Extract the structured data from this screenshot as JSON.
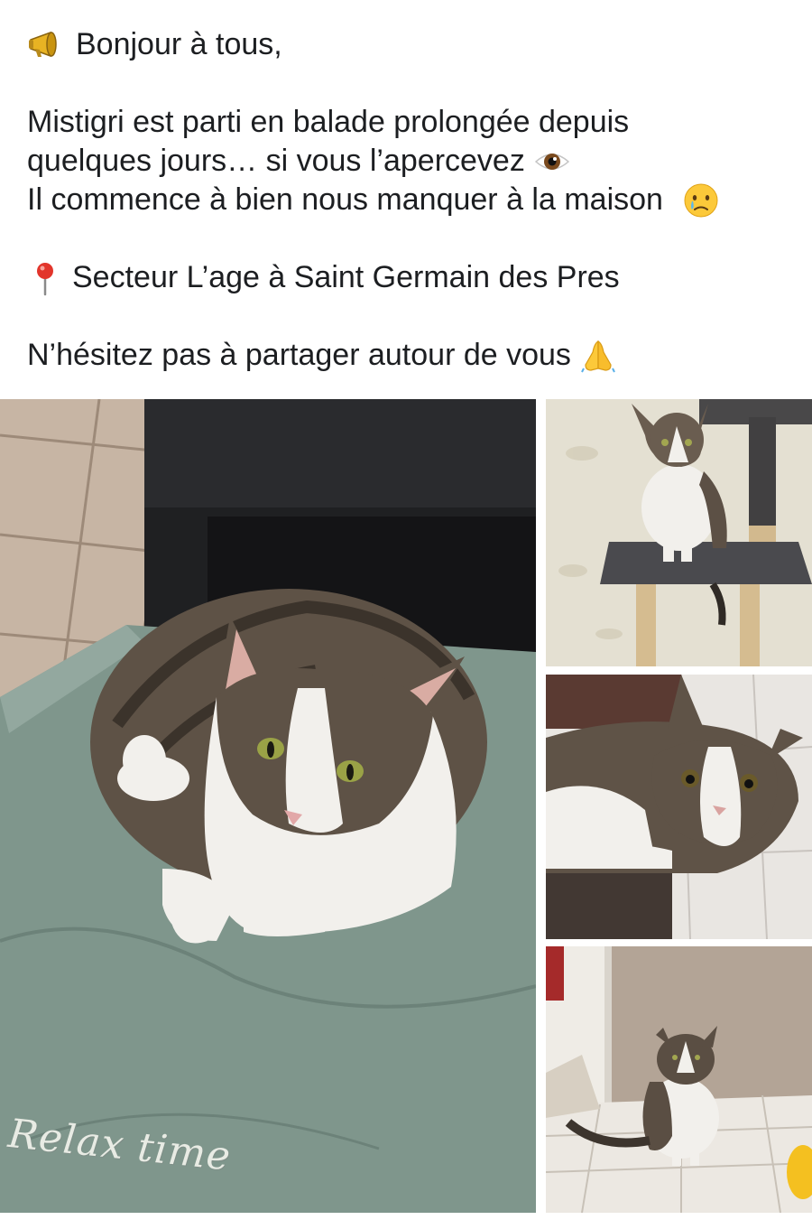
{
  "post": {
    "greeting_icon": "megaphone-icon",
    "greeting": "Bonjour à tous,",
    "line1": "Mistigri est parti en balade prolongée depuis",
    "line2": "quelques jours… si vous l’apercevez",
    "line2_icon": "eye-icon",
    "line3": "Il commence à bien nous manquer à la maison",
    "line3_icon": "sad-tear-face-icon",
    "location_icon": "pin-icon",
    "location": "Secteur L’age à Saint Germain des Pres",
    "line5": "N’hésitez pas à partager autour de vous",
    "line5_icon": "praying-hands-icon"
  },
  "gallery": {
    "main_photo_caption": "Relax time",
    "photos": [
      {
        "subject": "cat lying on green cushion"
      },
      {
        "subject": "cat sitting on cat tree"
      },
      {
        "subject": "cat close-up lying down"
      },
      {
        "subject": "cat sitting on tiled floor"
      }
    ]
  },
  "colors": {
    "text": "#1c1e21",
    "background": "#ffffff",
    "cushion": "#7f968c",
    "cat_white": "#f2f0ec",
    "cat_tabby": "#5e5246"
  }
}
